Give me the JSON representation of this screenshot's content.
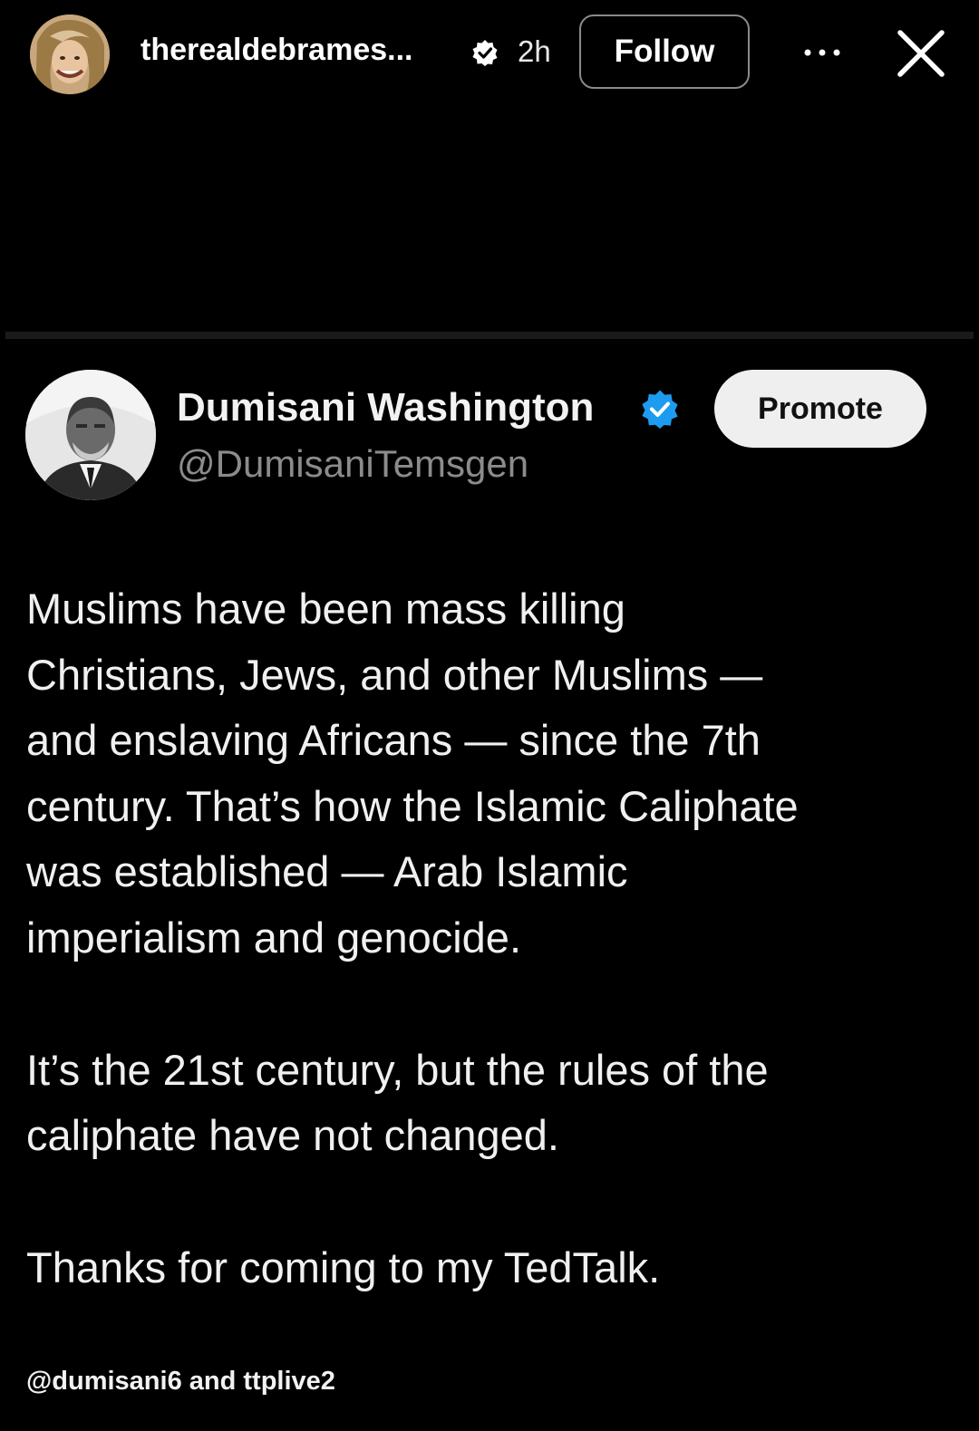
{
  "story": {
    "username": "therealdebrames...",
    "time": "2h",
    "follow_label": "Follow",
    "more_icon": "more-horizontal-icon",
    "close_icon": "close-icon"
  },
  "tweet": {
    "author_name": "Dumisani Washington",
    "handle": "@DumisaniTemsgen",
    "promote_label": "Promote",
    "verified_color": "#1d9bf0",
    "paragraphs": [
      "Muslims have been mass killing\nChristians, Jews, and other Muslims —\nand enslaving Africans — since the 7th\ncentury. That’s how the Islamic Caliphate\nwas established — Arab Islamic\nimperialism and genocide.",
      "It’s the 21st century, but the rules of the\ncaliphate have not changed.",
      "Thanks for coming to my TedTalk."
    ]
  },
  "credits": "@dumisani6 and ttplive2"
}
